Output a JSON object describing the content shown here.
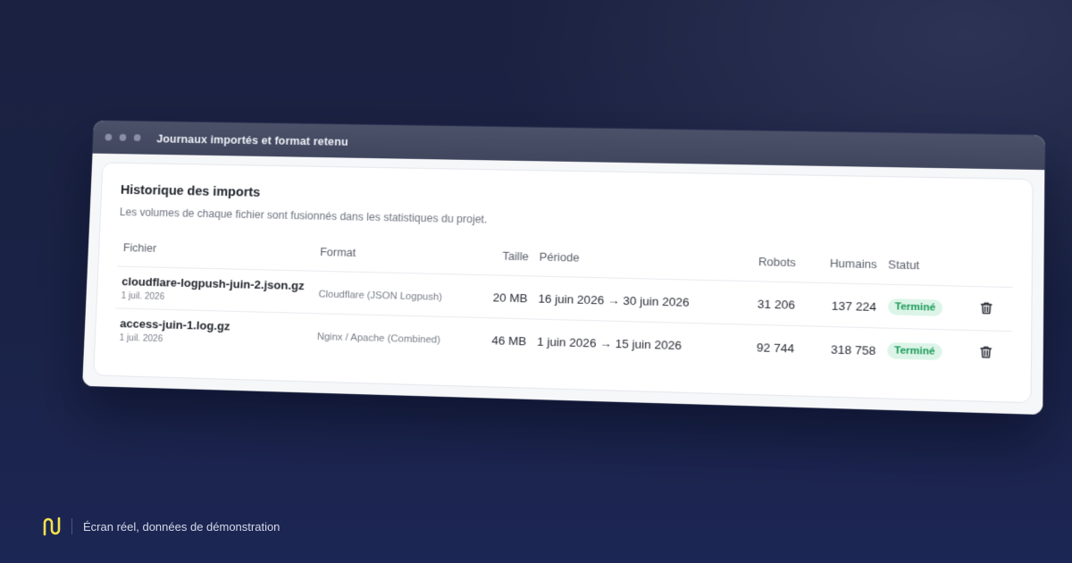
{
  "window": {
    "title": "Journaux importés et format retenu"
  },
  "card": {
    "title": "Historique des imports",
    "subtitle": "Les volumes de chaque fichier sont fusionnés dans les statistiques du projet."
  },
  "table": {
    "headers": {
      "file": "Fichier",
      "format": "Format",
      "size": "Taille",
      "period": "Période",
      "robots": "Robots",
      "humans": "Humains",
      "status": "Statut"
    },
    "rows": [
      {
        "file": "cloudflare-logpush-juin-2.json.gz",
        "date": "1 juil. 2026",
        "format": "Cloudflare (JSON Logpush)",
        "size": "20 MB",
        "period": "16 juin 2026 → 30 juin 2026",
        "robots": "31 206",
        "humans": "137 224",
        "status": "Terminé"
      },
      {
        "file": "access-juin-1.log.gz",
        "date": "1 juil. 2026",
        "format": "Nginx / Apache (Combined)",
        "size": "46 MB",
        "period": "1 juin 2026 → 15 juin 2026",
        "robots": "92 744",
        "humans": "318 758",
        "status": "Terminé"
      }
    ],
    "row_action_icon": "trash-icon"
  },
  "footer": {
    "logo_icon": "brand-logo-icon",
    "text": "Écran réel, données de démonstration"
  },
  "colors": {
    "background": "#1b2140",
    "accent_logo": "#f2e24b",
    "status_success_bg": "#dcf5e8",
    "status_success_text": "#1d9a5a"
  }
}
